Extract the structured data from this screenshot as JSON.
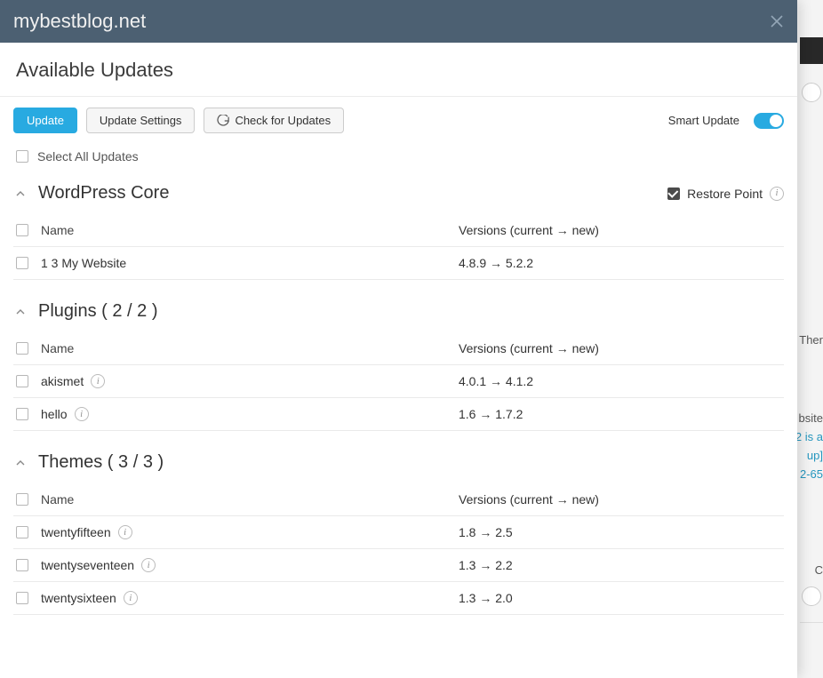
{
  "header": {
    "site": "mybestblog.net"
  },
  "page_title": "Available Updates",
  "toolbar": {
    "update": "Update",
    "settings": "Update Settings",
    "check": "Check for Updates",
    "smart_update": "Smart Update"
  },
  "select_all": "Select All Updates",
  "versions_header": "Versions (current → new)",
  "name_header": "Name",
  "restore_point": "Restore Point",
  "sections": {
    "core": {
      "title": "WordPress Core",
      "rows": [
        {
          "name": "1 3 My Website",
          "ver": "4.8.9 → 5.2.2",
          "has_info": false
        }
      ]
    },
    "plugins": {
      "title": "Plugins ( 2 / 2 )",
      "rows": [
        {
          "name": "akismet",
          "ver": "4.0.1 → 4.1.2",
          "has_info": true
        },
        {
          "name": "hello",
          "ver": "1.6 → 1.7.2",
          "has_info": true
        }
      ]
    },
    "themes": {
      "title": "Themes ( 3 / 3 )",
      "rows": [
        {
          "name": "twentyfifteen",
          "ver": "1.8 → 2.5",
          "has_info": true
        },
        {
          "name": "twentyseventeen",
          "ver": "1.3 → 2.2",
          "has_info": true
        },
        {
          "name": "twentysixteen",
          "ver": "1.3 → 2.0",
          "has_info": true
        }
      ]
    }
  },
  "background_fragments": {
    "f1": "Ther",
    "f2": "bsite",
    "f3": "2 is a",
    "f4": "up]",
    "f5": "2-65",
    "f6": "C"
  }
}
